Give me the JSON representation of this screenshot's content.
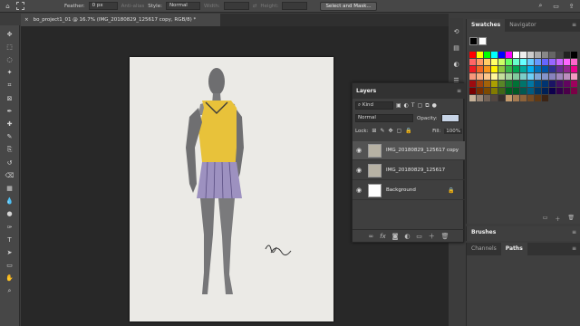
{
  "options_bar": {
    "feather_label": "Feather:",
    "feather_value": "0 px",
    "antialias_label": "Anti-alias",
    "style_label": "Style:",
    "style_value": "Normal",
    "width_label": "Width:",
    "height_label": "Height:",
    "select_mask_label": "Select and Mask..."
  },
  "document": {
    "tab_title": "bo_project1_01 @ 16.7% (IMG_20180829_125617 copy, RGB/8) *"
  },
  "tools": [
    "move-tool-icon",
    "marquee-tool-icon",
    "lasso-tool-icon",
    "quick-select-tool-icon",
    "crop-tool-icon",
    "frame-tool-icon",
    "eyedropper-tool-icon",
    "healing-brush-tool-icon",
    "brush-tool-icon",
    "clone-stamp-tool-icon",
    "history-brush-tool-icon",
    "eraser-tool-icon",
    "gradient-tool-icon",
    "blur-tool-icon",
    "dodge-tool-icon",
    "pen-tool-icon",
    "type-tool-icon",
    "path-select-tool-icon",
    "shape-tool-icon",
    "hand-tool-icon",
    "zoom-tool-icon"
  ],
  "swatches_panel": {
    "tab_swatches": "Swatches",
    "tab_navigator": "Navigator",
    "colors": [
      [
        "#ff0000",
        "#ffff00",
        "#00ff00",
        "#00ffff",
        "#0000ff",
        "#ff00ff",
        "#ffffff",
        "#eeeeee",
        "#cccccc",
        "#aaaaaa",
        "#888888",
        "#666666",
        "#444444",
        "#222222",
        "#000000"
      ],
      [
        "#ff6666",
        "#ff9966",
        "#ffcc66",
        "#ffff66",
        "#ccff66",
        "#66ff66",
        "#66ffcc",
        "#66ffff",
        "#66ccff",
        "#6699ff",
        "#6666ff",
        "#9966ff",
        "#cc66ff",
        "#ff66ff",
        "#ff66cc"
      ],
      [
        "#ee1c24",
        "#f26522",
        "#f7941d",
        "#fff200",
        "#8dc63f",
        "#39b54a",
        "#00a651",
        "#00a99d",
        "#00aeef",
        "#0072bc",
        "#0054a6",
        "#2e3192",
        "#662d91",
        "#92278f",
        "#ec008c"
      ],
      [
        "#f7977a",
        "#f9ad81",
        "#fdc68a",
        "#fff79a",
        "#c4df9b",
        "#a3d39c",
        "#82ca9d",
        "#7bcdc8",
        "#6ecff6",
        "#7ea7d8",
        "#8493ca",
        "#8882be",
        "#a187be",
        "#bc8dbf",
        "#f49ac2"
      ],
      [
        "#9e0b0f",
        "#a0410d",
        "#a36209",
        "#aba000",
        "#598527",
        "#1a7b30",
        "#007236",
        "#00746b",
        "#0076a3",
        "#004a80",
        "#003471",
        "#1b1464",
        "#440e62",
        "#630460",
        "#9e005d"
      ],
      [
        "#790000",
        "#7b2e00",
        "#7d4900",
        "#827b00",
        "#406618",
        "#005e20",
        "#005826",
        "#005952",
        "#005b7f",
        "#003663",
        "#002157",
        "#0d004c",
        "#32004b",
        "#4b0049",
        "#7b0046"
      ],
      [
        "#c7b299",
        "#998675",
        "#736357",
        "#534741",
        "#37302d",
        "#c69c6d",
        "#a67c52",
        "#8c6239",
        "#754c24",
        "#603913",
        "#3c2415"
      ]
    ]
  },
  "layers_panel": {
    "title": "Layers",
    "kind_label": "Kind",
    "blend_mode": "Normal",
    "opacity_label": "Opacity:",
    "lock_label": "Lock:",
    "fill_label": "Fill:",
    "fill_value": "100%",
    "layers": [
      {
        "name": "IMG_20180829_125617 copy"
      },
      {
        "name": "IMG_20180829_125617"
      },
      {
        "name": "Background"
      }
    ]
  },
  "brushes_panel": {
    "title": "Brushes"
  },
  "channels_panel": {
    "tab_channels": "Channels",
    "tab_paths": "Paths"
  }
}
